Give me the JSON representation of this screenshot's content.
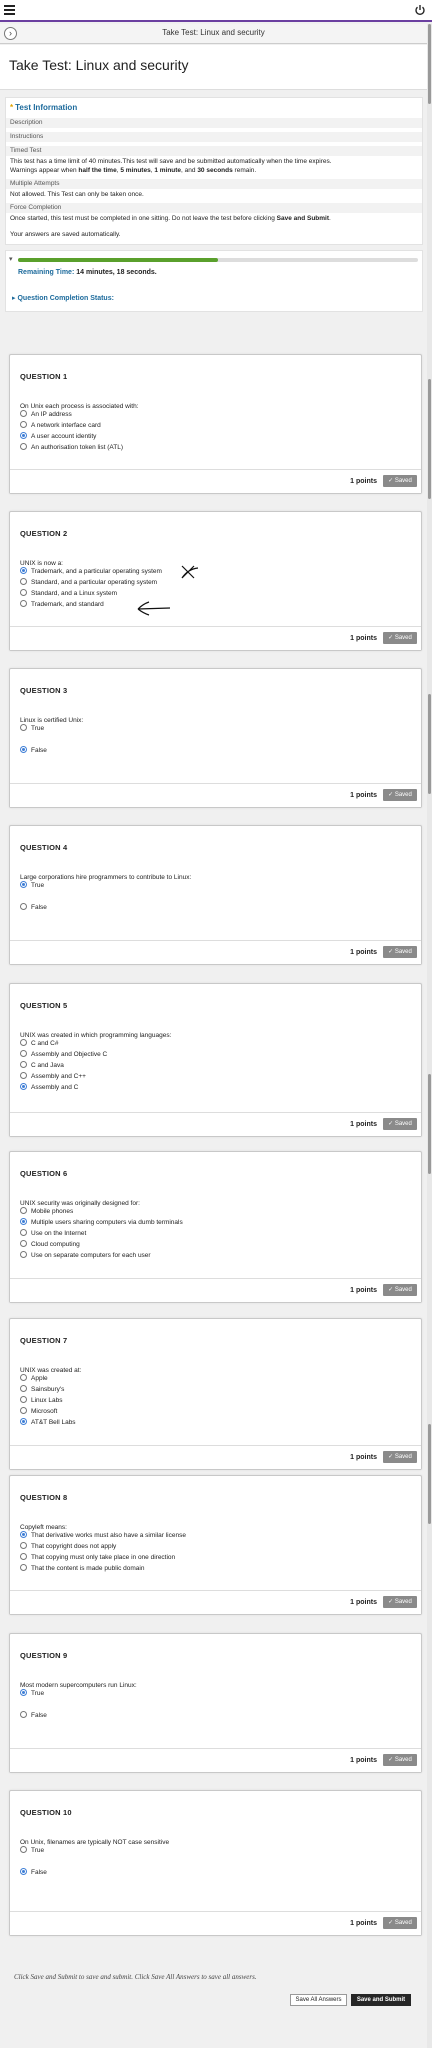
{
  "header": {
    "window_title": "Take Test: Linux and security",
    "page_title": "Take Test: Linux and security"
  },
  "info": {
    "heading": "Test Information",
    "description_label": "Description",
    "instructions_label": "Instructions",
    "timed_label": "Timed Test",
    "timed_text_1": "This test has a time limit of 40 minutes.This test will save and be submitted automatically when the time expires.",
    "timed_text_2_a": "Warnings appear when ",
    "timed_text_2_b": "half the time",
    "timed_text_2_c": ", ",
    "timed_text_2_d": "5 minutes",
    "timed_text_2_e": ", ",
    "timed_text_2_f": "1 minute",
    "timed_text_2_g": ", and ",
    "timed_text_2_h": "30 seconds",
    "timed_text_2_i": " remain.",
    "attempts_label": "Multiple Attempts",
    "attempts_text": "Not allowed. This Test can only be taken once.",
    "force_label": "Force Completion",
    "force_text_a": "Once started, this test must be completed in one sitting. Do not leave the test before clicking ",
    "force_text_b": "Save and Submit",
    "force_text_c": ".",
    "autosave_text": "Your answers are saved automatically."
  },
  "timer": {
    "progress_fraction": 0.5,
    "remaining_label": "Remaining Time: ",
    "remaining_value": "14 minutes, 18 seconds.",
    "completion_status_label": "Question Completion Status:"
  },
  "questions": [
    {
      "title": "QUESTION 1",
      "text": "On Unix each process is associated with:",
      "options": [
        "An IP address",
        "A network interface card",
        "A user account identity",
        "An authorisation token list (ATL)"
      ],
      "selected": 2,
      "points": "1 points",
      "status": "Saved"
    },
    {
      "title": "QUESTION 2",
      "text": "UNIX is now a:",
      "options": [
        "Trademark, and a particular operating system",
        "Standard, and a particular operating system",
        "Standard, and a Linux system",
        "Trademark, and standard"
      ],
      "selected": 0,
      "points": "1 points",
      "status": "Saved"
    },
    {
      "title": "QUESTION 3",
      "text": "Linux is certified Unix:",
      "options": [
        "True",
        "False"
      ],
      "selected": 1,
      "points": "1 points",
      "status": "Saved"
    },
    {
      "title": "QUESTION 4",
      "text": "Large corporations hire programmers to contribute to Linux:",
      "options": [
        "True",
        "False"
      ],
      "selected": 0,
      "points": "1 points",
      "status": "Saved"
    },
    {
      "title": "QUESTION 5",
      "text": "UNIX was created in which programming languages:",
      "options": [
        "C and C#",
        "Assembly and Objective C",
        "C and Java",
        "Assembly and C++",
        "Assembly and C"
      ],
      "selected": 4,
      "points": "1 points",
      "status": "Saved"
    },
    {
      "title": "QUESTION 6",
      "text": "UNIX security was originally designed for:",
      "options": [
        "Mobile phones",
        "Multiple users sharing computers via dumb terminals",
        "Use on the Internet",
        "Cloud computing",
        "Use on separate computers for each user"
      ],
      "selected": 1,
      "points": "1 points",
      "status": "Saved"
    },
    {
      "title": "QUESTION 7",
      "text": "UNIX was created at:",
      "options": [
        "Apple",
        "Sainsbury's",
        "Linux Labs",
        "Microsoft",
        "AT&T Bell Labs"
      ],
      "selected": 4,
      "points": "1 points",
      "status": "Saved"
    },
    {
      "title": "QUESTION 8",
      "text": "Copyleft means:",
      "options": [
        "That derivative works must also have a similar license",
        "That copyright does not apply",
        "That copying must only take place in one direction",
        "That the content is made public domain"
      ],
      "selected": 0,
      "points": "1 points",
      "status": "Saved"
    },
    {
      "title": "QUESTION 9",
      "text": "Most modern supercomputers run Linux:",
      "options": [
        "True",
        "False"
      ],
      "selected": 0,
      "points": "1 points",
      "status": "Saved"
    },
    {
      "title": "QUESTION 10",
      "text": "On Unix, filenames are typically NOT case sensitive",
      "options": [
        "True",
        "False"
      ],
      "selected": 1,
      "points": "1 points",
      "status": "Saved"
    }
  ],
  "footer": {
    "note": "Click Save and Submit to save and submit. Click Save All Answers to save all answers.",
    "save_all_label": "Save All Answers",
    "submit_label": "Save and Submit"
  }
}
